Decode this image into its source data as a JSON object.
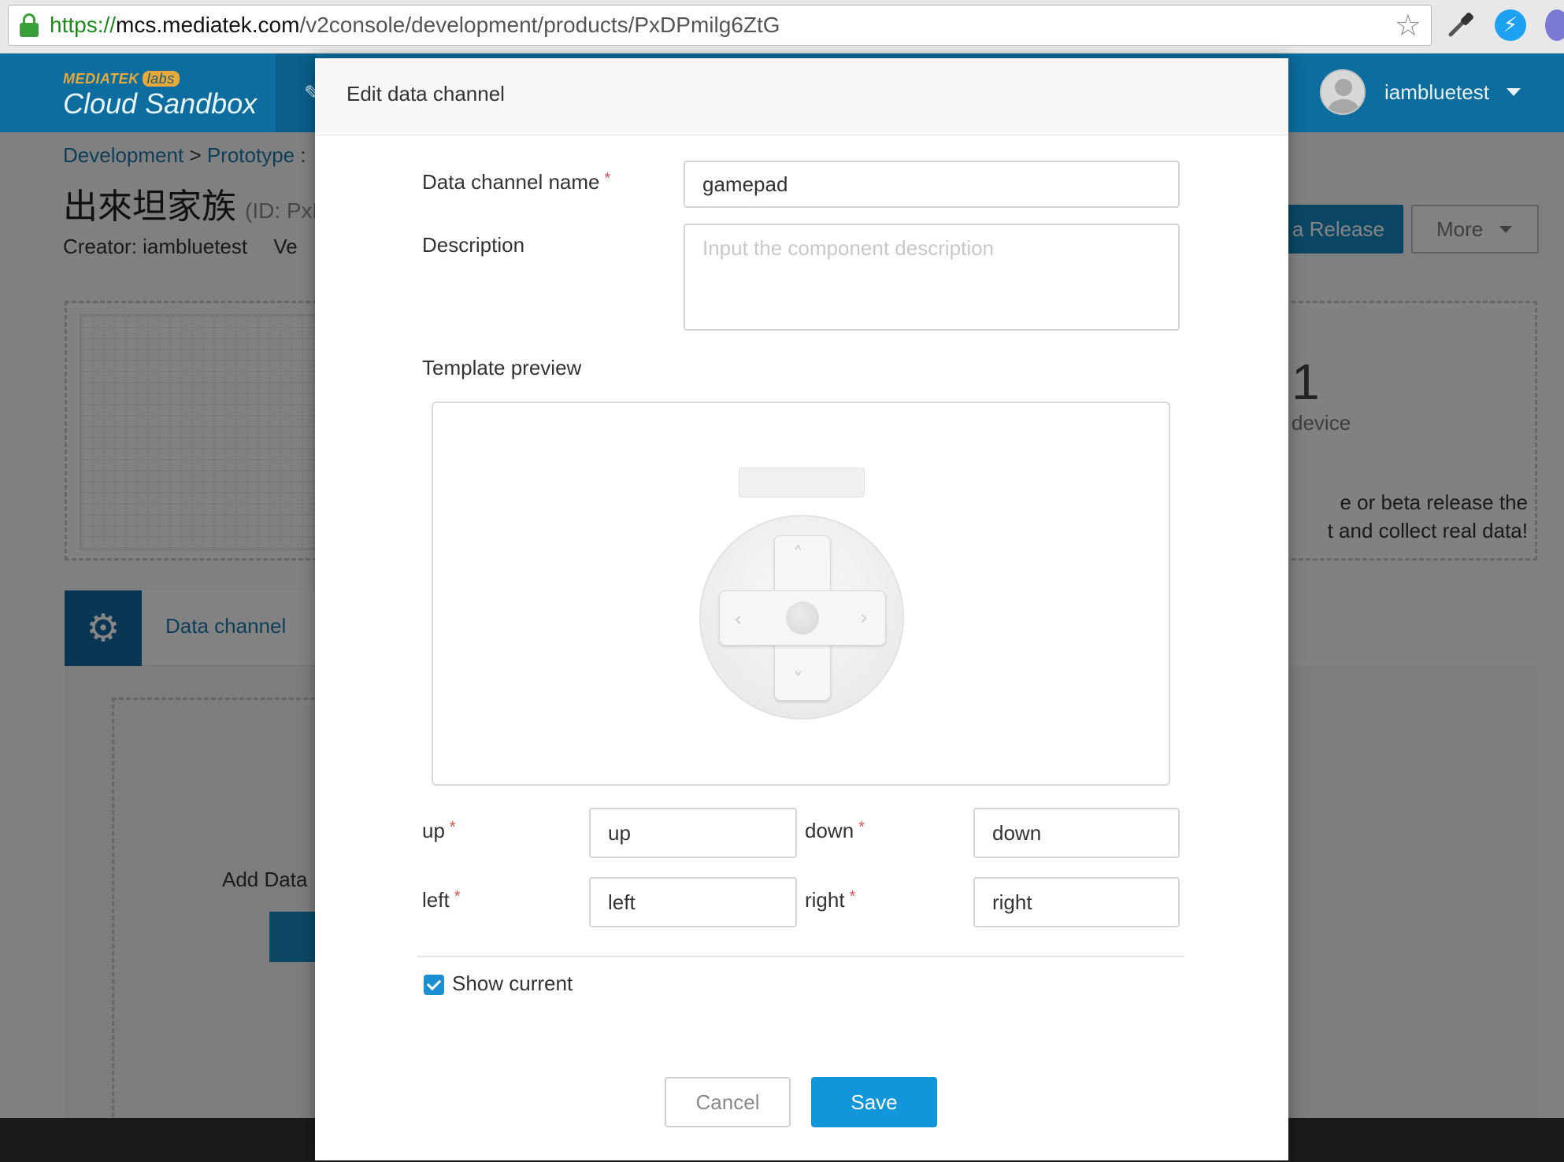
{
  "browser": {
    "url_scheme": "https://",
    "url_host": "mcs.mediatek.com",
    "url_path": "/v2console/development/products/PxDPmilg6ZtG"
  },
  "header": {
    "brand_top": "MEDIATEK",
    "brand_labs": "labs",
    "brand_name": "Cloud Sandbox",
    "username": "iambluetest"
  },
  "background": {
    "breadcrumb_development": "Development",
    "breadcrumb_sep": " > ",
    "breadcrumb_prototype": "Prototype",
    "breadcrumb_tail": " :",
    "product_name": "出來坦家族",
    "product_id_partial": "(ID: PxD",
    "creator": "Creator: iambluetest",
    "version_partial": "Ve",
    "release_button": "a Release",
    "more_button": "More",
    "device_count": "1",
    "device_label": "device",
    "release_text_line1": "e or beta release the",
    "release_text_line2": "t and collect real data!",
    "data_channel_tab": "Data channel",
    "add_data_label": "Add Data"
  },
  "modal": {
    "title": "Edit data channel",
    "name_label": "Data channel name",
    "name_value": "gamepad",
    "description_label": "Description",
    "description_placeholder": "Input the component description",
    "template_preview_label": "Template preview",
    "up_label": "up",
    "up_value": "up",
    "down_label": "down",
    "down_value": "down",
    "left_label": "left",
    "left_value": "left",
    "right_label": "right",
    "right_value": "right",
    "show_current_label": "Show current",
    "show_current_checked": true,
    "cancel_button": "Cancel",
    "save_button": "Save",
    "required_marker": "*"
  },
  "colors": {
    "brand_header": "#0c6d9e",
    "primary_button": "#1196d9",
    "required": "#d9534f"
  }
}
